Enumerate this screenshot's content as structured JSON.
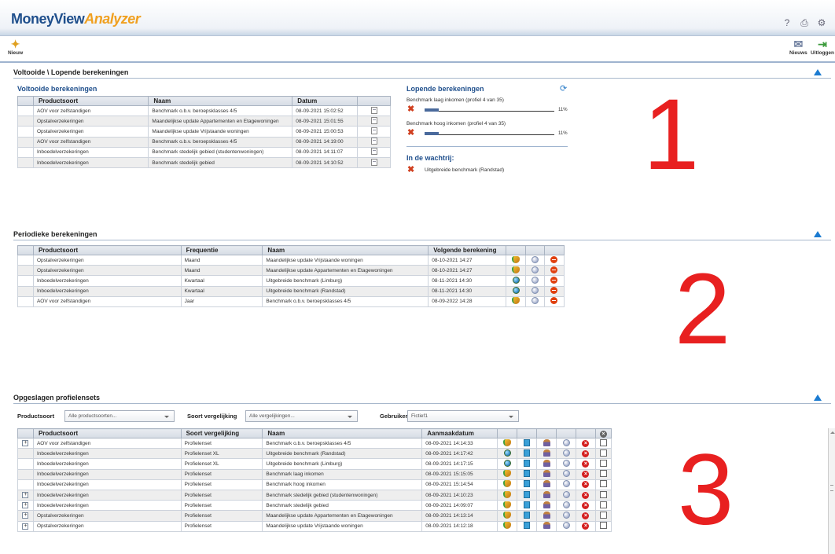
{
  "app": {
    "title_part1": "MoneyView",
    "title_part2": "Analyzer"
  },
  "top_icons": [
    "help-icon",
    "print-icon",
    "settings-icon"
  ],
  "toolbar": {
    "new_label": "Nieuw",
    "news_label": "Nieuws",
    "logout_label": "Uitloggen"
  },
  "section1": {
    "title": "Voltooide \\ Lopende berekeningen",
    "completed": {
      "title": "Voltooide berekeningen",
      "columns": [
        "Productsoort",
        "Naam",
        "Datum"
      ],
      "rows": [
        {
          "productsoort": "AOV voor zelfstandigen",
          "naam": "Benchmark o.b.v. beroepsklasses 4/5",
          "datum": "08-09-2021 15:02:52"
        },
        {
          "productsoort": "Opstalverzekeringen",
          "naam": "Maandelijkse update Appartementen en Etagewoningen",
          "datum": "08-09-2021 15:01:55"
        },
        {
          "productsoort": "Opstalverzekeringen",
          "naam": "Maandelijkse update Vrijstaande woningen",
          "datum": "08-09-2021 15:00:53"
        },
        {
          "productsoort": "AOV voor zelfstandigen",
          "naam": "Benchmark o.b.v. beroepsklasses 4/5",
          "datum": "08-09-2021 14:19:00"
        },
        {
          "productsoort": "Inboedelverzekeringen",
          "naam": "Benchmark stedelijk gebied (studentenwoningen)",
          "datum": "08-09-2021 14:11:07"
        },
        {
          "productsoort": "Inboedelverzekeringen",
          "naam": "Benchmark stedelijk gebied",
          "datum": "08-09-2021 14:10:52"
        }
      ]
    },
    "running": {
      "title": "Lopende berekeningen",
      "items": [
        {
          "label": "Benchmark laag inkomen (profiel 4 van 35)",
          "progress_pct": 11,
          "pct_text": "11%"
        },
        {
          "label": "Benchmark hoog inkomen (profiel 4 van 35)",
          "progress_pct": 11,
          "pct_text": "11%"
        }
      ]
    },
    "queue": {
      "title": "In de wachtrij:",
      "items": [
        "Uitgebreide benchmark (Randstad)"
      ]
    }
  },
  "section2": {
    "title": "Periodieke berekeningen",
    "columns": [
      "Productsoort",
      "Frequentie",
      "Naam",
      "Volgende berekening"
    ],
    "rows": [
      {
        "productsoort": "Opstalverzekeringen",
        "frequentie": "Maand",
        "naam": "Maandelijkse update Vrijstaande woningen",
        "volgende": "08-10-2021 14:27",
        "type_icon": "run-icon"
      },
      {
        "productsoort": "Opstalverzekeringen",
        "frequentie": "Maand",
        "naam": "Maandelijkse update Appartementen en Etagewoningen",
        "volgende": "08-10-2021 14:27",
        "type_icon": "run-icon"
      },
      {
        "productsoort": "Inboedelverzekeringen",
        "frequentie": "Kwartaal",
        "naam": "Uitgebreide benchmark (Limburg)",
        "volgende": "08-11-2021 14:30",
        "type_icon": "earth-icon"
      },
      {
        "productsoort": "Inboedelverzekeringen",
        "frequentie": "Kwartaal",
        "naam": "Uitgebreide benchmark (Randstad)",
        "volgende": "08-11-2021 14:30",
        "type_icon": "earth-icon"
      },
      {
        "productsoort": "AOV voor zelfstandigen",
        "frequentie": "Jaar",
        "naam": "Benchmark o.b.v. beroepsklasses 4/5",
        "volgende": "08-09-2022 14:28",
        "type_icon": "run-icon"
      }
    ]
  },
  "section3": {
    "title": "Opgeslagen profielensets",
    "filters": {
      "productsoort_label": "Productsoort",
      "productsoort_value": "Alle productsoorten...",
      "vergelijking_label": "Soort vergelijking",
      "vergelijking_value": "Alle vergelijkingen...",
      "gebruiker_label": "Gebruiker",
      "gebruiker_value": "Fictief1"
    },
    "columns": [
      "Productsoort",
      "Soort vergelijking",
      "Naam",
      "Aanmaakdatum"
    ],
    "rows": [
      {
        "expand": true,
        "productsoort": "AOV voor zelfstandigen",
        "soort": "Profielenset",
        "naam": "Benchmark o.b.v. beroepsklasses 4/5",
        "datum": "08-09-2021 14:14:33",
        "type_icon": "run-icon"
      },
      {
        "expand": false,
        "productsoort": "Inboedelverzekeringen",
        "soort": "Profielenset XL",
        "naam": "Uitgebreide benchmark (Randstad)",
        "datum": "08-09-2021 14:17:42",
        "type_icon": "earth-icon"
      },
      {
        "expand": false,
        "productsoort": "Inboedelverzekeringen",
        "soort": "Profielenset XL",
        "naam": "Uitgebreide benchmark (Limburg)",
        "datum": "08-09-2021 14:17:15",
        "type_icon": "earth-icon"
      },
      {
        "expand": false,
        "productsoort": "Inboedelverzekeringen",
        "soort": "Profielenset",
        "naam": "Benchmark laag inkomen",
        "datum": "08-09-2021 15:15:05",
        "type_icon": "run-icon"
      },
      {
        "expand": false,
        "productsoort": "Inboedelverzekeringen",
        "soort": "Profielenset",
        "naam": "Benchmark hoog inkomen",
        "datum": "08-09-2021 15:14:54",
        "type_icon": "run-icon"
      },
      {
        "expand": true,
        "productsoort": "Inboedelverzekeringen",
        "soort": "Profielenset",
        "naam": "Benchmark stedelijk gebied (studentenwoningen)",
        "datum": "08-09-2021 14:10:23",
        "type_icon": "run-icon"
      },
      {
        "expand": true,
        "productsoort": "Inboedelverzekeringen",
        "soort": "Profielenset",
        "naam": "Benchmark stedelijk gebied",
        "datum": "08-09-2021 14:09:07",
        "type_icon": "run-icon"
      },
      {
        "expand": true,
        "productsoort": "Opstalverzekeringen",
        "soort": "Profielenset",
        "naam": "Maandelijkse update Appartementen en Etagewoningen",
        "datum": "08-09-2021 14:13:14",
        "type_icon": "run-icon"
      },
      {
        "expand": true,
        "productsoort": "Opstalverzekeringen",
        "soort": "Profielenset",
        "naam": "Maandelijkse update Vrijstaande woningen",
        "datum": "08-09-2021 14:12:18",
        "type_icon": "run-icon"
      }
    ]
  },
  "annotations": [
    "1",
    "2",
    "3"
  ],
  "colors": {
    "accent": "#1f4f8c",
    "brand_orange": "#f0a020",
    "annotation_red": "#e82020"
  }
}
